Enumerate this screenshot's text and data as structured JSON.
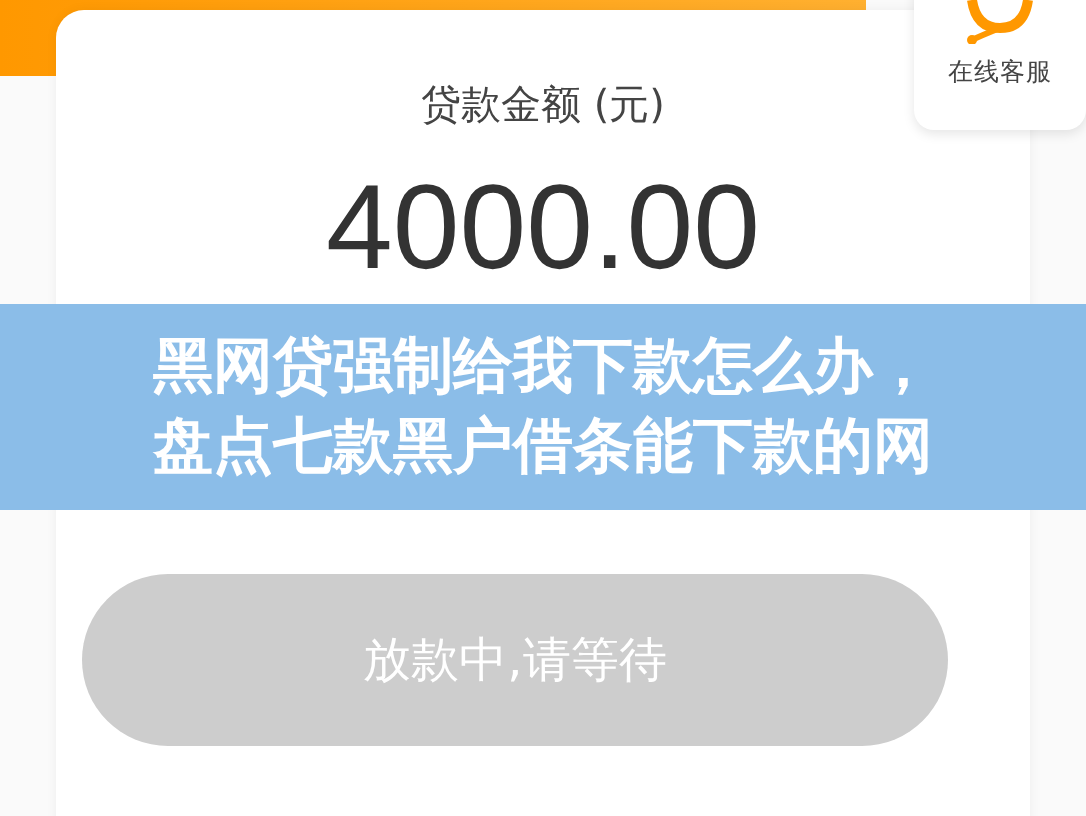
{
  "support": {
    "label": "在线客服"
  },
  "loan": {
    "amount_label": "贷款金额 (元)",
    "amount": "4000.00"
  },
  "banner": {
    "lines": [
      "黑网贷强制给我下款怎么办，",
      "盘点七款黑户借条能下款的网"
    ]
  },
  "action_button": {
    "label": "放款中,请等待",
    "disabled": true
  }
}
